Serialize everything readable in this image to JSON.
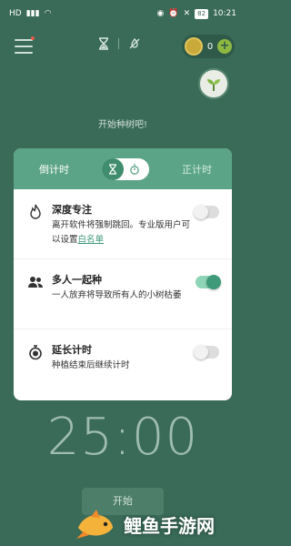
{
  "statusbar": {
    "left_info": "HD",
    "battery": "82",
    "time": "10:21"
  },
  "header": {
    "coins": "0",
    "plus": "+"
  },
  "hint": "开始种树吧!",
  "panel": {
    "tab_countdown": "倒计时",
    "tab_countup": "正计时",
    "options": [
      {
        "title": "深度专注",
        "desc": "离开软件将强制跳回。专业版用户可以设置",
        "link": "白名单",
        "toggle_state": "off",
        "icon": "flame-icon"
      },
      {
        "title": "多人一起种",
        "desc": "一人放弃将导致所有人的小树枯萎",
        "toggle_state": "on",
        "icon": "people-icon"
      },
      {
        "title": "延长计时",
        "desc": "种植结束后继续计时",
        "toggle_state": "off",
        "icon": "stopwatch-icon"
      }
    ]
  },
  "timer": "25:00",
  "start_label": "开始",
  "watermark": "鲤鱼手游网",
  "colors": {
    "background": "#3a6a58",
    "accent": "#5ba487",
    "toggle_on": "#3f9a7a"
  }
}
